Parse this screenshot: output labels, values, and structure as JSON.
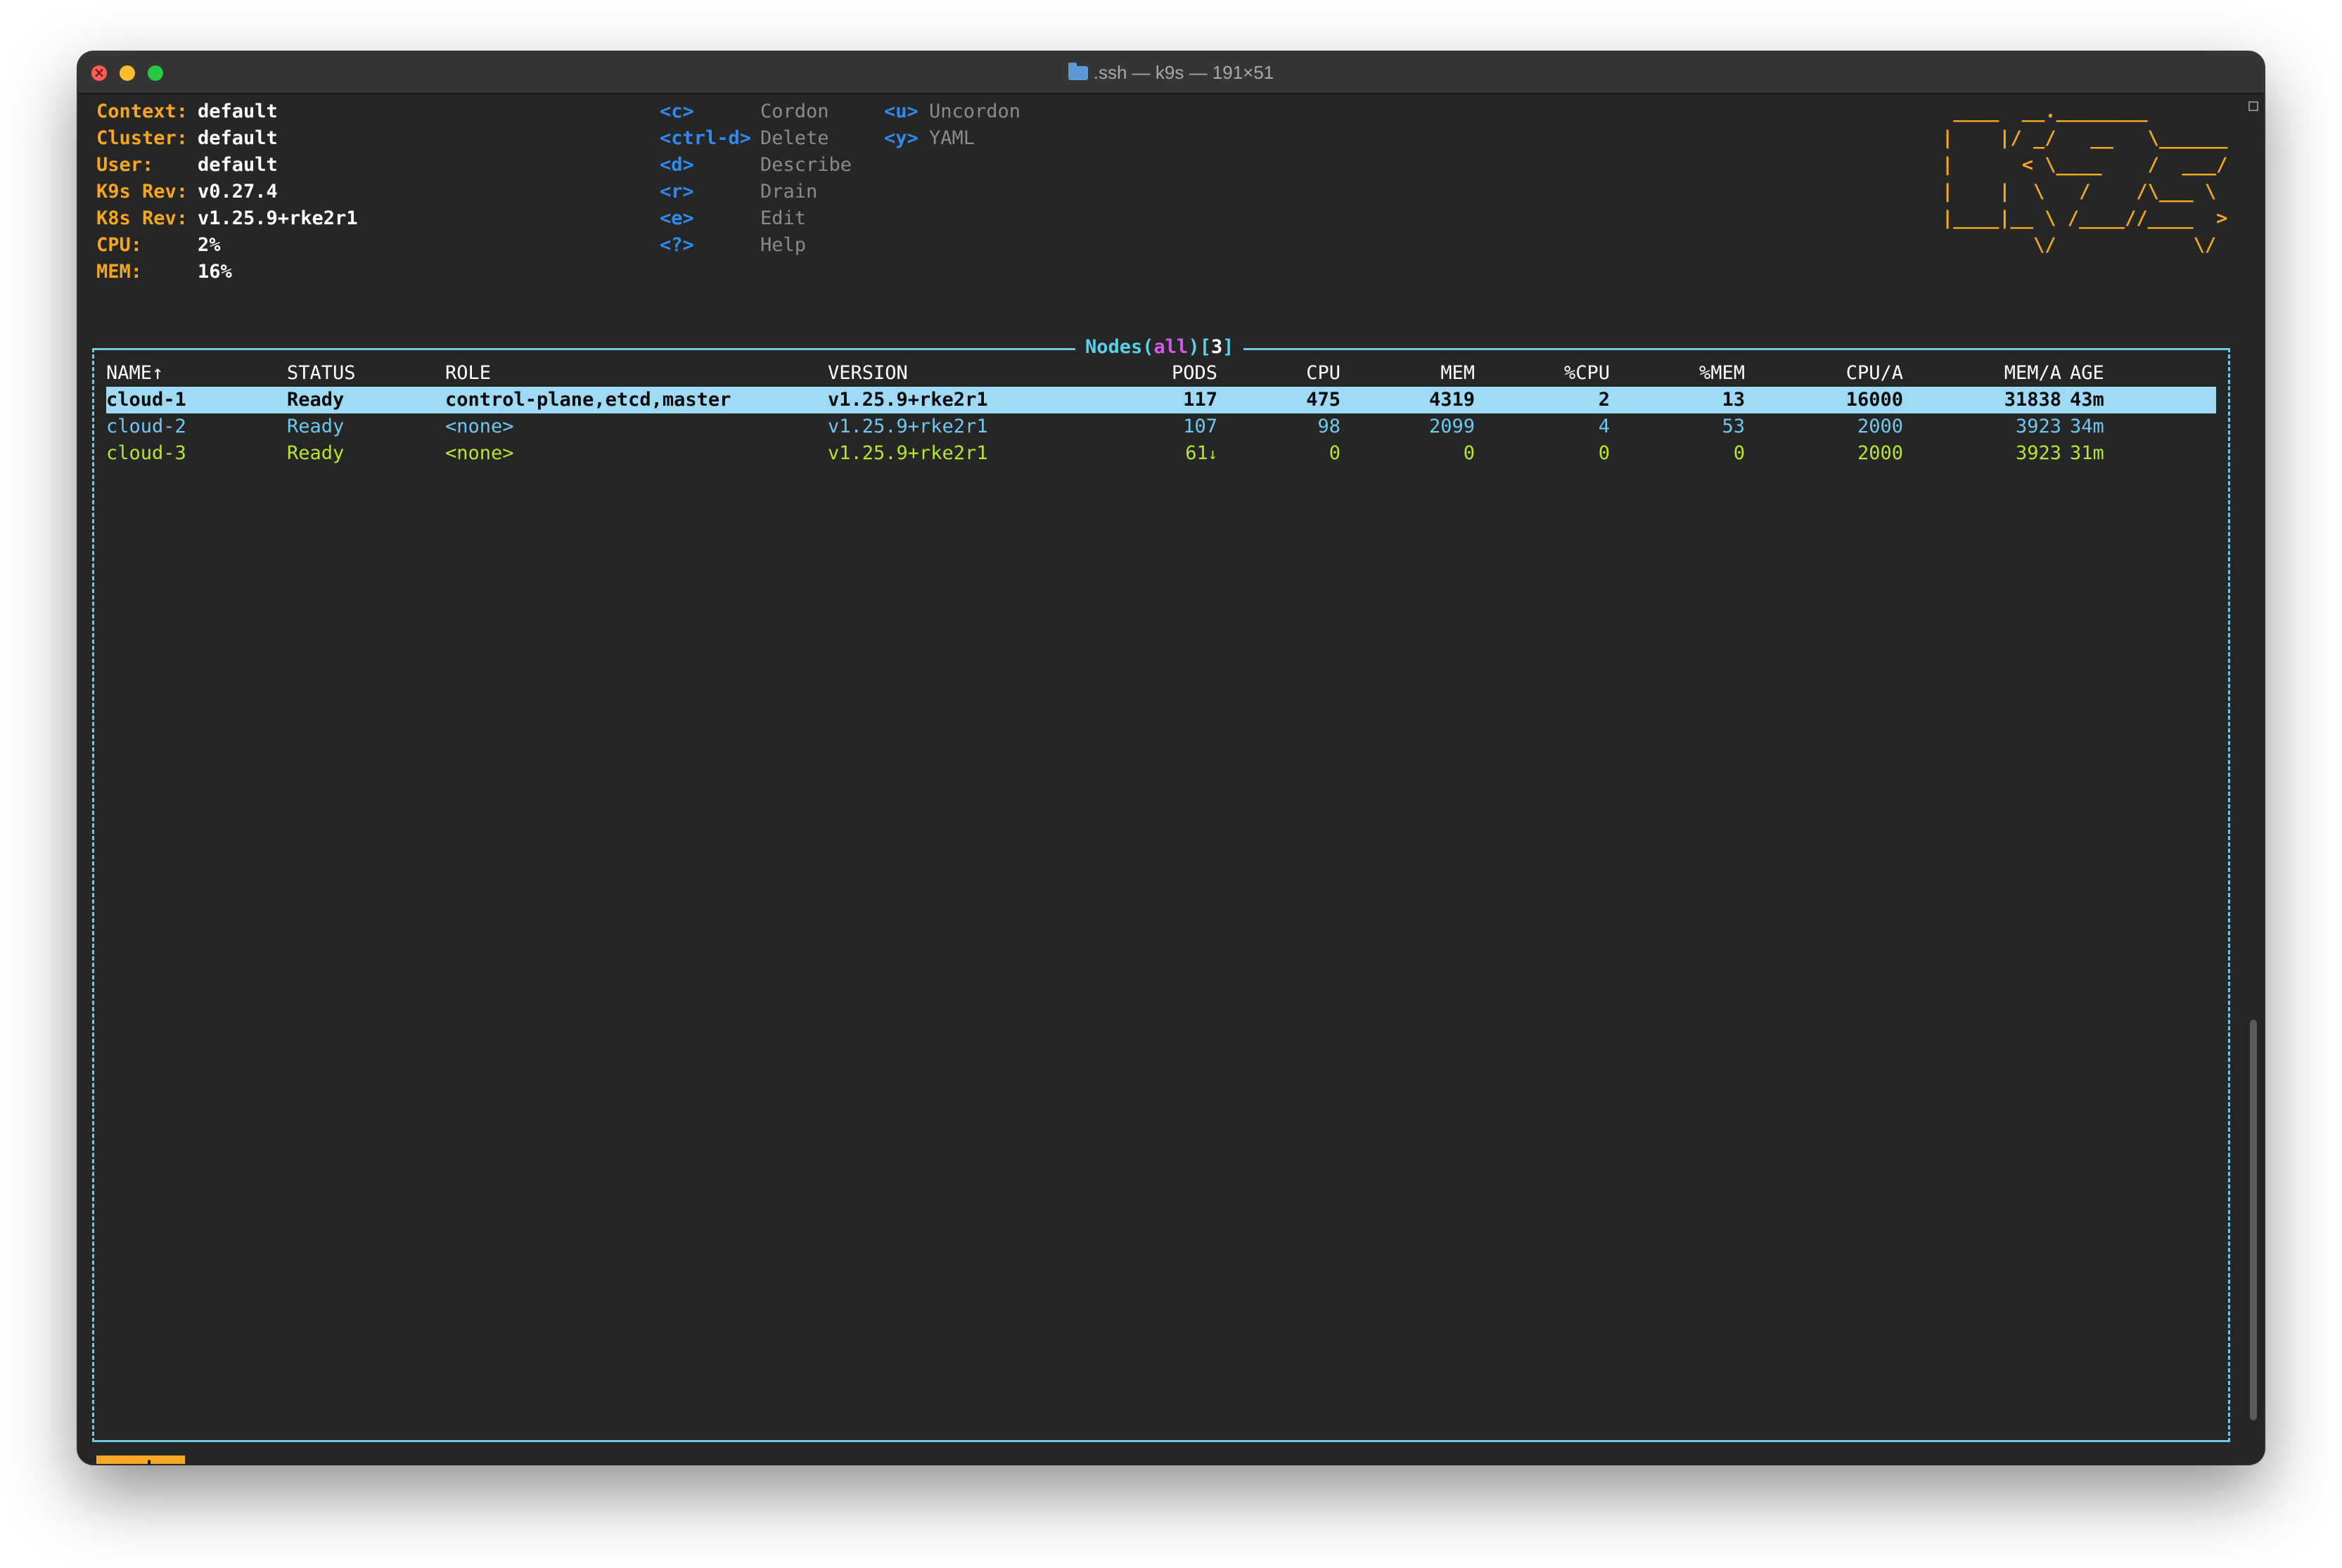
{
  "window": {
    "title": ".ssh — k9s — 191×51"
  },
  "info": [
    {
      "label": "Context:",
      "value": "default"
    },
    {
      "label": "Cluster:",
      "value": "default"
    },
    {
      "label": "User:",
      "value": "default"
    },
    {
      "label": "K9s Rev:",
      "value": "v0.27.4"
    },
    {
      "label": "K8s Rev:",
      "value": "v1.25.9+rke2r1"
    },
    {
      "label": "CPU:",
      "value": "2%"
    },
    {
      "label": "MEM:",
      "value": "16%"
    }
  ],
  "shortcuts_col1": [
    {
      "key": "<c>",
      "action": "Cordon"
    },
    {
      "key": "<ctrl-d>",
      "action": "Delete"
    },
    {
      "key": "<d>",
      "action": "Describe"
    },
    {
      "key": "<r>",
      "action": "Drain"
    },
    {
      "key": "<e>",
      "action": "Edit"
    },
    {
      "key": "<?>",
      "action": "Help"
    }
  ],
  "shortcuts_col2": [
    {
      "key": "<u>",
      "action": "Uncordon"
    },
    {
      "key": "<y>",
      "action": "YAML"
    }
  ],
  "logo_ascii": " ____  __.________\n|    |/ _/   __   \\______\n|      < \\____    /  ___/\n|    |  \\   /    /\\___ \\\n|____|__ \\ /____//____  >\n        \\/            \\/",
  "panel": {
    "resource": "Nodes",
    "filter": "all",
    "count": "3"
  },
  "columns": {
    "name": "NAME↑",
    "status": "STATUS",
    "role": "ROLE",
    "version": "VERSION",
    "pods": "PODS",
    "cpu": "CPU",
    "mem": "MEM",
    "pcpu": "%CPU",
    "pmem": "%MEM",
    "cpua": "CPU/A",
    "mema": "MEM/A",
    "age": "AGE"
  },
  "rows": [
    {
      "name": "cloud-1",
      "status": "Ready",
      "role": "control-plane,etcd,master",
      "version": "v1.25.9+rke2r1",
      "pods": "117",
      "cpu": "475",
      "mem": "4319",
      "pcpu": "2",
      "pmem": "13",
      "cpua": "16000",
      "mema": "31838",
      "age": "43m"
    },
    {
      "name": "cloud-2",
      "status": "Ready",
      "role": "<none>",
      "version": "v1.25.9+rke2r1",
      "pods": "107",
      "cpu": "98",
      "mem": "2099",
      "pcpu": "4",
      "pmem": "53",
      "cpua": "2000",
      "mema": "3923",
      "age": "34m"
    },
    {
      "name": "cloud-3",
      "status": "Ready",
      "role": "<none>",
      "version": "v1.25.9+rke2r1",
      "pods": "61",
      "pods_indicator": "↓",
      "cpu": "0",
      "mem": "0",
      "pcpu": "0",
      "pmem": "0",
      "cpua": "2000",
      "mema": "3923",
      "age": "31m"
    }
  ],
  "footer": {
    "crumb": "<node>"
  },
  "colors": {
    "label": "#f5a623",
    "key": "#2e8bf0",
    "frame": "#6ec8e6",
    "selected_row": "#9ed9f5",
    "row_text": "#6ec8f0",
    "row_last": "#b6e532",
    "filter": "#d25be6"
  }
}
